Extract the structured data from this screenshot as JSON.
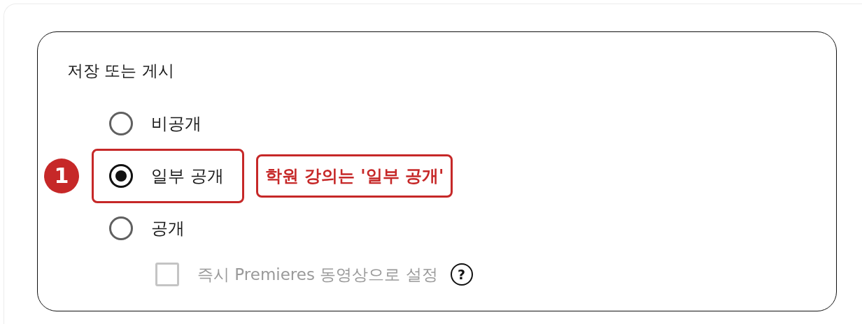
{
  "section": {
    "title": "저장 또는 게시",
    "options": [
      {
        "label": "비공개",
        "selected": false,
        "highlighted": false
      },
      {
        "label": "일부 공개",
        "selected": true,
        "highlighted": true
      },
      {
        "label": "공개",
        "selected": false,
        "highlighted": false
      }
    ],
    "premiere": {
      "label": "즉시 Premieres 동영상으로 설정",
      "checked": false,
      "disabled": true,
      "help": "?"
    }
  },
  "annotation": {
    "badge": "1",
    "note": "학원 강의는 '일부 공개'"
  }
}
